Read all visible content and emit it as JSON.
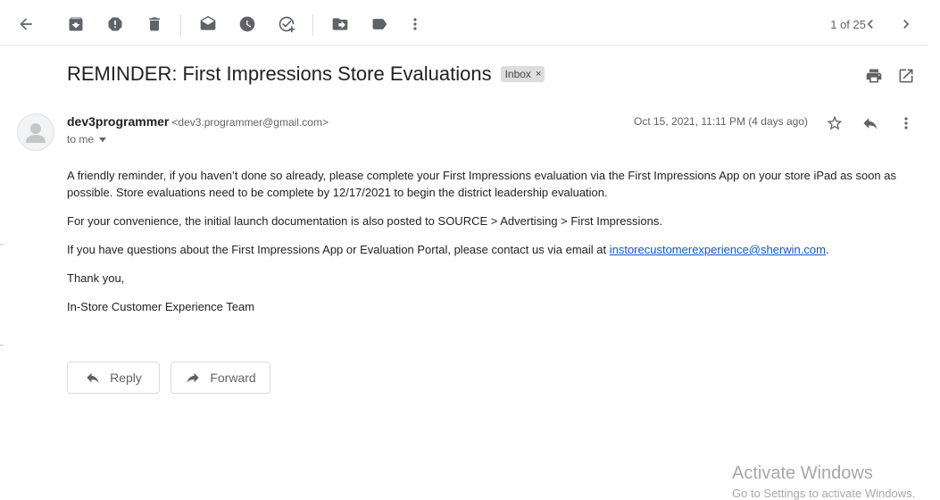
{
  "toolbar": {
    "icons": [
      "back-arrow-icon",
      "archive-icon",
      "report-spam-icon",
      "delete-icon",
      "mark-unread-icon",
      "snooze-icon",
      "add-to-tasks-icon",
      "move-to-icon",
      "labels-icon",
      "more-vert-icon"
    ],
    "pager_text": "1 of 25"
  },
  "message": {
    "subject": "REMINDER: First Impressions Store Evaluations",
    "label": "Inbox",
    "label_close": "×",
    "sender_name": "dev3programmer",
    "sender_email": "<dev3.programmer@gmail.com>",
    "to_text": "to me",
    "date": "Oct 15, 2021, 11:11 PM (4 days ago)",
    "body": {
      "p1": "A friendly reminder, if you haven’t done so already, please complete your First Impressions evaluation via the First Impressions App on your store iPad as soon as possible. Store evaluations need to be complete by 12/17/2021 to begin the district leadership evaluation.",
      "p2": "For your convenience, the initial launch documentation is also posted to SOURCE > Advertising > First Impressions.",
      "p3_prefix": "If you have questions about the First Impressions App or Evaluation Portal, please contact us via email at ",
      "p3_link": "instorecustomerexperience@sherwin.com",
      "p3_suffix": ".",
      "p4": "Thank you,",
      "p5": "In-Store Customer Experience Team"
    }
  },
  "actions": {
    "reply_label": "Reply",
    "forward_label": "Forward"
  },
  "watermark": {
    "title": "Activate Windows",
    "subtitle": "Go to Settings to activate Windows."
  }
}
